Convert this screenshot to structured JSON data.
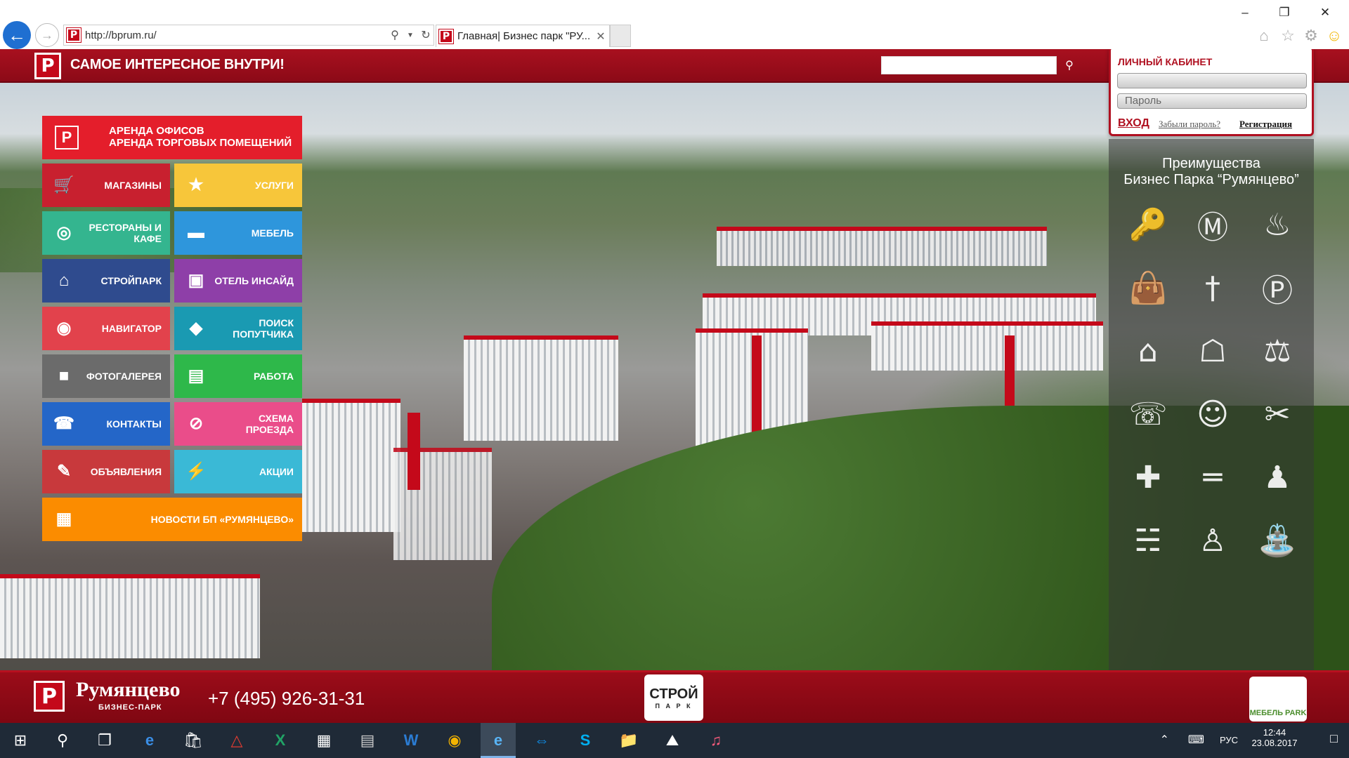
{
  "browser": {
    "url": "http://bprum.ru/",
    "tab_title": "Главная| Бизнес парк \"РУ...",
    "favicon_letter": "P"
  },
  "site": {
    "slogan": "САМОЕ ИНТЕРЕСНОЕ ВНУТРИ!",
    "logo_letter": "P",
    "search_placeholder": ""
  },
  "login": {
    "title": "ЛИЧНЫЙ КАБИНЕТ",
    "login_value": "",
    "password_placeholder": "Пароль",
    "enter_label": "ВХОД",
    "forgot_label": "Забыли пароль?",
    "register_label": "Регистрация"
  },
  "menu": {
    "rent": {
      "line1": "АРЕНДА ОФИСОВ",
      "line2": "АРЕНДА ТОРГОВЫХ ПОМЕЩЕНИЙ",
      "color": "#e41e2b"
    },
    "tiles": [
      {
        "label": "МАГАЗИНЫ",
        "icon": "cart-icon",
        "color": "#c8202f"
      },
      {
        "label": "УСЛУГИ",
        "icon": "star-icon",
        "color": "#f7c63a"
      },
      {
        "label": "РЕСТОРАНЫ И КАФЕ",
        "icon": "plate-icon",
        "color": "#34b58f"
      },
      {
        "label": "МЕБЕЛЬ",
        "icon": "sofa-icon",
        "color": "#2e96dc"
      },
      {
        "label": "СТРОЙПАРК",
        "icon": "house-icon",
        "color": "#2f4b8e"
      },
      {
        "label": "ОТЕЛЬ ИНСАЙД",
        "icon": "hotel-icon",
        "color": "#8e3fa8"
      },
      {
        "label": "НАВИГАТОР",
        "icon": "pin-icon",
        "color": "#e2424c"
      },
      {
        "label": "ПОИСК ПОПУТЧИКА",
        "icon": "car-icon",
        "color": "#1a9ab2"
      },
      {
        "label": "ФОТОГАЛЕРЕЯ",
        "icon": "camera-icon",
        "color": "#6b6b6b"
      },
      {
        "label": "РАБОТА",
        "icon": "briefcase-icon",
        "color": "#2eb84a"
      },
      {
        "label": "КОНТАКТЫ",
        "icon": "phone-icon",
        "color": "#2466c8"
      },
      {
        "label": "СХЕМА ПРОЕЗДА",
        "icon": "compass-icon",
        "color": "#ea4d8a"
      },
      {
        "label": "ОБЪЯВЛЕНИЯ",
        "icon": "edit-icon",
        "color": "#c8393c"
      },
      {
        "label": "АКЦИИ",
        "icon": "lightning-icon",
        "color": "#3ab9d6"
      }
    ],
    "news": {
      "label": "НОВОСТИ БП «РУМЯНЦЕВО»",
      "icon": "newspaper-icon",
      "color": "#fb8c00"
    }
  },
  "advantages": {
    "title_line1": "Преимущества",
    "title_line2": "Бизнес Парка “Румянцево”",
    "icons": [
      "keys-icon",
      "metro-icon",
      "car-wash-icon",
      "shopping-bag-icon",
      "fork-knife-icon",
      "parking-icon",
      "bank-icon",
      "armchair-icon",
      "taxi-icon",
      "mobile-phone-icon",
      "baby-icon",
      "scissors-icon",
      "medical-cross-icon",
      "dumbbell-icon",
      "worker-icon",
      "bed-icon",
      "bowling-icon",
      "bucket-icon"
    ]
  },
  "footer": {
    "brand": "Румянцево",
    "brand_sub": "БИЗНЕС-ПАРК",
    "phone": "+7 (495) 926-31-31",
    "stroy_text": "СТРОЙ",
    "stroy_sub": "П А Р К",
    "mebel_text": "МЕБЕЛЬ PARK"
  },
  "taskbar": {
    "lang": "РУС",
    "time": "12:44",
    "date": "23.08.2017"
  }
}
